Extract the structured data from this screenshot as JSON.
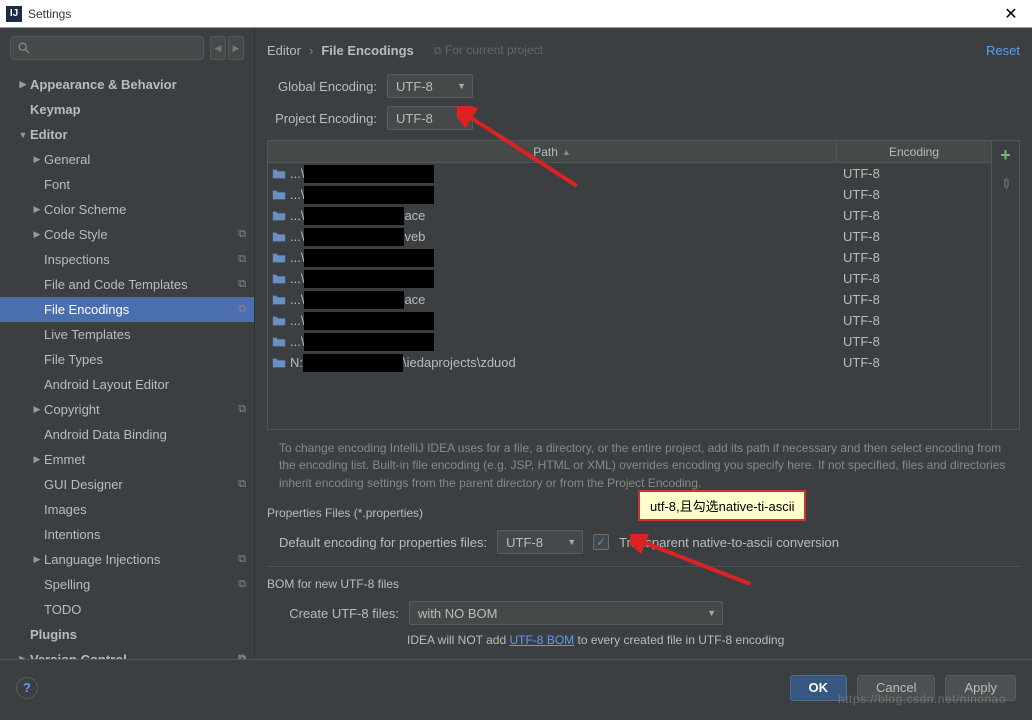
{
  "window": {
    "title": "Settings"
  },
  "search": {
    "placeholder": ""
  },
  "sidebar": {
    "items": [
      {
        "label": "Appearance & Behavior",
        "level": 0,
        "arrow": "▶",
        "bold": true
      },
      {
        "label": "Keymap",
        "level": 0,
        "arrow": "",
        "bold": true
      },
      {
        "label": "Editor",
        "level": 0,
        "arrow": "▼",
        "bold": true
      },
      {
        "label": "General",
        "level": 1,
        "arrow": "▶"
      },
      {
        "label": "Font",
        "level": 1,
        "arrow": ""
      },
      {
        "label": "Color Scheme",
        "level": 1,
        "arrow": "▶"
      },
      {
        "label": "Code Style",
        "level": 1,
        "arrow": "▶",
        "copy": true
      },
      {
        "label": "Inspections",
        "level": 1,
        "arrow": "",
        "copy": true
      },
      {
        "label": "File and Code Templates",
        "level": 1,
        "arrow": "",
        "copy": true
      },
      {
        "label": "File Encodings",
        "level": 1,
        "arrow": "",
        "copy": true,
        "selected": true
      },
      {
        "label": "Live Templates",
        "level": 1,
        "arrow": ""
      },
      {
        "label": "File Types",
        "level": 1,
        "arrow": ""
      },
      {
        "label": "Android Layout Editor",
        "level": 1,
        "arrow": ""
      },
      {
        "label": "Copyright",
        "level": 1,
        "arrow": "▶",
        "copy": true
      },
      {
        "label": "Android Data Binding",
        "level": 1,
        "arrow": ""
      },
      {
        "label": "Emmet",
        "level": 1,
        "arrow": "▶"
      },
      {
        "label": "GUI Designer",
        "level": 1,
        "arrow": "",
        "copy": true
      },
      {
        "label": "Images",
        "level": 1,
        "arrow": ""
      },
      {
        "label": "Intentions",
        "level": 1,
        "arrow": ""
      },
      {
        "label": "Language Injections",
        "level": 1,
        "arrow": "▶",
        "copy": true
      },
      {
        "label": "Spelling",
        "level": 1,
        "arrow": "",
        "copy": true
      },
      {
        "label": "TODO",
        "level": 1,
        "arrow": ""
      },
      {
        "label": "Plugins",
        "level": 0,
        "arrow": "",
        "bold": true
      },
      {
        "label": "Version Control",
        "level": 0,
        "arrow": "▶",
        "bold": true,
        "copy": true
      }
    ]
  },
  "breadcrumb": {
    "root": "Editor",
    "current": "File Encodings",
    "for_project": "For current project",
    "reset": "Reset"
  },
  "global_encoding": {
    "label": "Global Encoding:",
    "value": "UTF-8"
  },
  "project_encoding": {
    "label": "Project Encoding:",
    "value": "UTF-8"
  },
  "table": {
    "col_path": "Path",
    "col_enc": "Encoding",
    "rows": [
      {
        "pre": "...\\",
        "redact": "w1",
        "suf": "",
        "enc": "UTF-8"
      },
      {
        "pre": "...\\",
        "redact": "w1",
        "suf": "",
        "enc": "UTF-8"
      },
      {
        "pre": "...\\",
        "redact": "w2",
        "suf": "ace",
        "enc": "UTF-8"
      },
      {
        "pre": "...\\",
        "redact": "w2",
        "suf": "veb",
        "enc": "UTF-8"
      },
      {
        "pre": "...\\",
        "redact": "w1",
        "suf": "",
        "enc": "UTF-8"
      },
      {
        "pre": "...\\",
        "redact": "w1",
        "suf": "",
        "enc": "UTF-8"
      },
      {
        "pre": "...\\",
        "redact": "w2",
        "suf": "ace",
        "enc": "UTF-8"
      },
      {
        "pre": "...\\",
        "redact": "w1",
        "suf": "",
        "enc": "UTF-8"
      },
      {
        "pre": "...\\",
        "redact": "w1",
        "suf": "",
        "enc": "UTF-8"
      },
      {
        "pre": "N:",
        "redact": "w2",
        "suf": "\\iedaprojects\\zduod",
        "enc": "UTF-8"
      }
    ]
  },
  "help_text": "To change encoding IntelliJ IDEA uses for a file, a directory, or the entire project, add its path if necessary and then select encoding from the encoding list. Built-in file encoding (e.g. JSP, HTML or XML) overrides encoding you specify here. If not specified, files and directories inherit encoding settings from the parent directory or from the Project Encoding.",
  "properties": {
    "section": "Properties Files (*.properties)",
    "default_label": "Default encoding for properties files:",
    "value": "UTF-8",
    "checkbox_label": "Transparent native-to-ascii conversion"
  },
  "bom": {
    "section": "BOM for new UTF-8 files",
    "create_label": "Create UTF-8 files:",
    "value": "with NO BOM",
    "note_pre": "IDEA will NOT add ",
    "note_link": "UTF-8 BOM",
    "note_post": " to every created file in UTF-8 encoding"
  },
  "buttons": {
    "ok": "OK",
    "cancel": "Cancel",
    "apply": "Apply"
  },
  "annotation": {
    "callout": "utf-8,且勾选native-ti-ascii"
  },
  "watermark": "https://blog.csdn.net/ninonao"
}
